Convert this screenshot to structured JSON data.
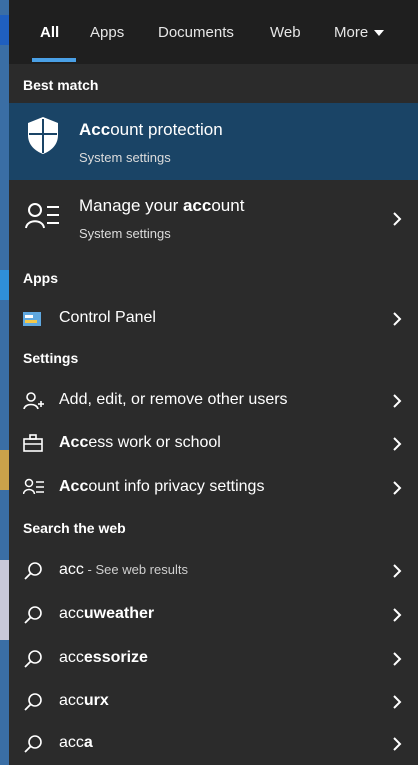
{
  "tabs": [
    {
      "label": "All"
    },
    {
      "label": "Apps"
    },
    {
      "label": "Documents"
    },
    {
      "label": "Web"
    },
    {
      "label": "More"
    }
  ],
  "sections": {
    "best_match": "Best match",
    "apps": "Apps",
    "settings": "Settings",
    "search_web": "Search the web"
  },
  "best_match": {
    "title_bold": "Acc",
    "title_rest": "ount protection",
    "subtitle": "System settings"
  },
  "manage_account": {
    "title_pre": "Manage your ",
    "title_bold": "acc",
    "title_post": "ount",
    "subtitle": "System settings"
  },
  "apps": [
    {
      "label": "Control Panel"
    }
  ],
  "settings": [
    {
      "pre": "Add, edit, or remove other users",
      "bold": "",
      "post": ""
    },
    {
      "pre": "",
      "bold": "Acc",
      "post": "ess work or school"
    },
    {
      "pre": "",
      "bold": "Acc",
      "post": "ount info privacy settings"
    }
  ],
  "web": [
    {
      "pre": "acc",
      "bold": "",
      "post": "",
      "suffix": " - See web results"
    },
    {
      "pre": "acc",
      "bold": "uweather",
      "post": "",
      "suffix": ""
    },
    {
      "pre": "acc",
      "bold": "essorize",
      "post": "",
      "suffix": ""
    },
    {
      "pre": "acc",
      "bold": "urx",
      "post": "",
      "suffix": ""
    },
    {
      "pre": "acc",
      "bold": "a",
      "post": "",
      "suffix": ""
    }
  ],
  "colors": {
    "accent": "#4aa0e6",
    "selected_bg": "#1a4466",
    "panel_bg": "#2b2b2b"
  }
}
